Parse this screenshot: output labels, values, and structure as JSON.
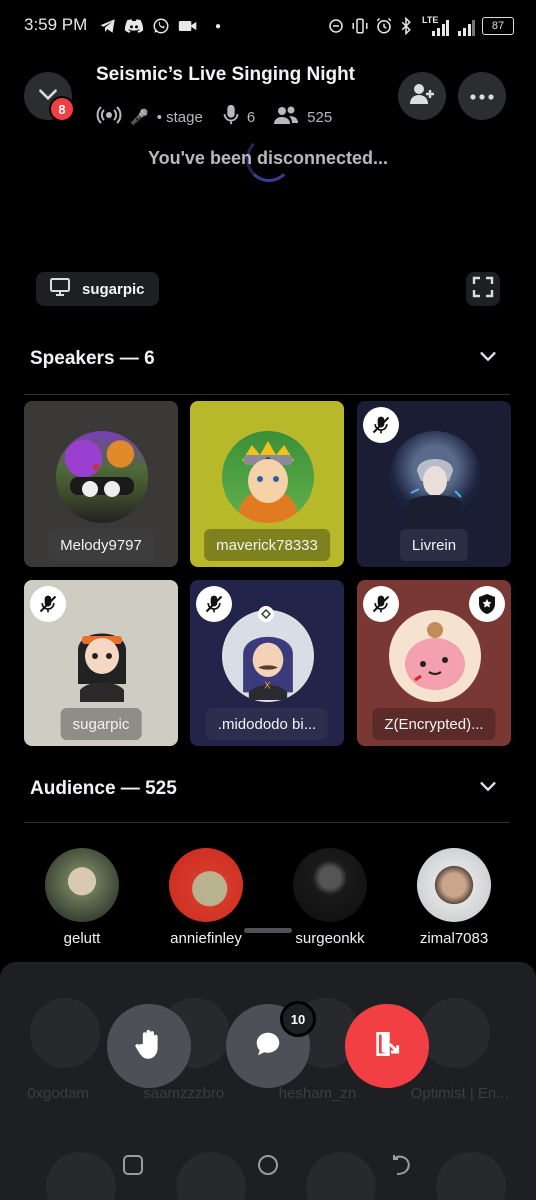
{
  "status_bar": {
    "time": "3:59 PM",
    "battery": "87",
    "network": "LTE",
    "icons": [
      "telegram-icon",
      "discord-icon",
      "whatsapp-icon",
      "video-icon",
      "dot-icon",
      "sync-icon",
      "vibrate-icon",
      "alarm-icon",
      "bluetooth-icon",
      "signal-icon",
      "signal-icon"
    ]
  },
  "header": {
    "title": "Seismic’s Live Singing Night",
    "notification_count": "8",
    "stage_label": "• stage",
    "speakers_count": "6",
    "listeners_count": "525",
    "connection_status": "You've been disconnected..."
  },
  "stream": {
    "streamer": "sugarpic"
  },
  "speakers": {
    "heading": "Speakers — 6",
    "tiles": [
      {
        "name": "Melody9797",
        "muted": false,
        "moderator": false,
        "bg": "#3b3838"
      },
      {
        "name": "maverick78333",
        "muted": false,
        "moderator": false,
        "bg": "#b8b92a"
      },
      {
        "name": "Livrein",
        "muted": true,
        "moderator": false,
        "bg": "#1a1d33"
      },
      {
        "name": "sugarpic",
        "muted": true,
        "moderator": false,
        "bg": "#cfccc4"
      },
      {
        "name": ".midododo bi...",
        "muted": true,
        "moderator": false,
        "bg": "#23244a"
      },
      {
        "name": "Z(Encrypted)...",
        "muted": true,
        "moderator": true,
        "bg": "#7a3835"
      }
    ]
  },
  "audience": {
    "heading": "Audience — 525",
    "members": [
      {
        "name": "gelutt"
      },
      {
        "name": "anniefinley"
      },
      {
        "name": "surgeonkk"
      },
      {
        "name": "zimal7083"
      }
    ],
    "obscured_members": [
      "0xgodam",
      "saamzzzbro",
      "hesham_zn",
      "Optimist | En..."
    ]
  },
  "actions": {
    "chat_unread": "10"
  },
  "colors": {
    "accent_red": "#f23f43",
    "surface": "#2b2d31",
    "sheet": "#1e1f22",
    "raise_hand_bg": "#4e5058"
  }
}
